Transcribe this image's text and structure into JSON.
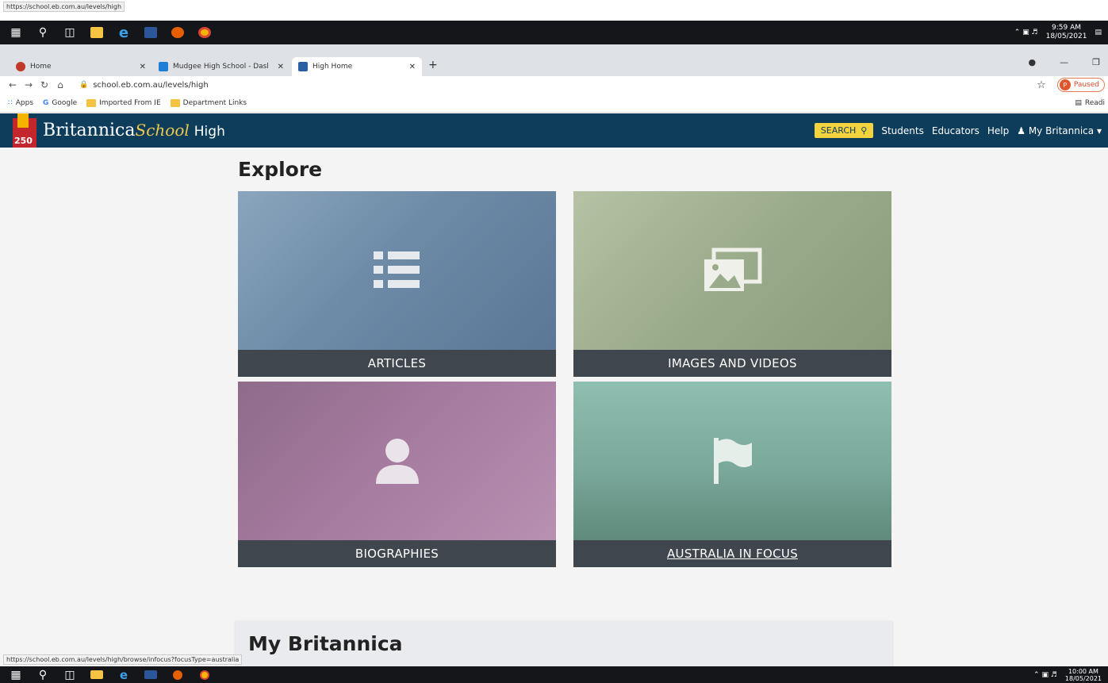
{
  "top_url": "https://school.eb.com.au/levels/high",
  "taskbar_top": {
    "clock_time": "9:59 AM",
    "clock_date": "18/05/2021"
  },
  "taskbar_bottom": {
    "clock_time": "10:00 AM",
    "clock_date": "18/05/2021"
  },
  "browser": {
    "tabs": [
      {
        "title": "Home",
        "color": "#c0392b"
      },
      {
        "title": "Mudgee High School - Dashboar",
        "color": "#1f7ed6"
      },
      {
        "title": "High Home",
        "color": "#2a5fa0"
      }
    ],
    "new_tab": "+",
    "url": "school.eb.com.au/levels/high",
    "profile_initial": "P",
    "profile_status": "Paused",
    "bookmarks": [
      {
        "label": "Apps"
      },
      {
        "label": "Google"
      },
      {
        "label": "Imported From IE"
      },
      {
        "label": "Department Links"
      }
    ],
    "reading_list": "Readi"
  },
  "site": {
    "logo_number": "250",
    "brand_main": "Britannica",
    "brand_school": "School",
    "brand_level": "High",
    "nav": {
      "search": "SEARCH",
      "students": "Students",
      "educators": "Educators",
      "help": "Help",
      "my_britannica": "My Britannica"
    }
  },
  "explore": {
    "title": "Explore",
    "cards": [
      {
        "label": "ARTICLES",
        "tint": "#7391ad"
      },
      {
        "label": "IMAGES AND VIDEOS",
        "tint": "#9aab8b"
      },
      {
        "label": "BIOGRAPHIES",
        "tint": "#a47a9e"
      },
      {
        "label": "AUSTRALIA IN FOCUS",
        "tint": "#7aa89a"
      }
    ]
  },
  "my_britannica": {
    "title": "My Britannica"
  },
  "status_bar_url": "https://school.eb.com.au/levels/high/browse/infocus?focusType=australia"
}
